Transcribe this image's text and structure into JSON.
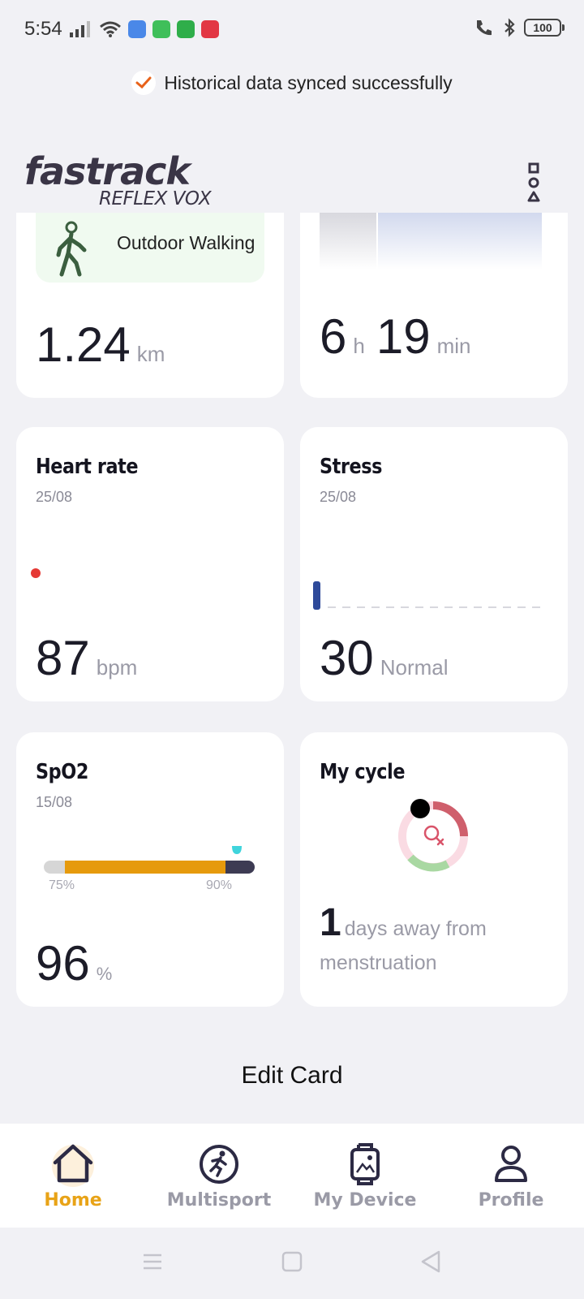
{
  "status_bar": {
    "time": "5:54",
    "battery": "100",
    "app_badges": [
      {
        "icon": "calendar-app-icon",
        "color": "#4a88e8"
      },
      {
        "icon": "chat-app-icon",
        "color": "#3fbf5a"
      },
      {
        "icon": "store-app-icon",
        "color": "#2fae4a"
      },
      {
        "icon": "zomato-app-icon",
        "color": "#e23744"
      }
    ]
  },
  "toast": {
    "text": "Historical data synced successfully"
  },
  "header": {
    "logo_main": "fastrack",
    "logo_sub": "REFLEX VOX"
  },
  "cards": {
    "activity": {
      "chip_label": "Outdoor Walking",
      "value": "1.24",
      "unit": "km"
    },
    "sleep": {
      "hours": "6",
      "hours_unit": "h",
      "minutes": "19",
      "minutes_unit": "min"
    },
    "heart_rate": {
      "title": "Heart rate",
      "date": "25/08",
      "value": "87",
      "unit": "bpm"
    },
    "stress": {
      "title": "Stress",
      "date": "25/08",
      "value": "30",
      "status": "Normal"
    },
    "spo2": {
      "title": "SpO2",
      "date": "15/08",
      "value": "96",
      "unit": "%",
      "label_low": "75%",
      "label_high": "90%",
      "marker_level": 0.96
    },
    "cycle": {
      "title": "My cycle",
      "days": "1",
      "text": "days away from menstruation"
    }
  },
  "edit_card": {
    "label": "Edit Card"
  },
  "nav": {
    "items": [
      {
        "label": "Home",
        "icon": "home-icon",
        "active": true
      },
      {
        "label": "Multisport",
        "icon": "multisport-icon",
        "active": false
      },
      {
        "label": "My Device",
        "icon": "watch-icon",
        "active": false
      },
      {
        "label": "Profile",
        "icon": "profile-icon",
        "active": false
      }
    ]
  },
  "colors": {
    "accent": "#e8a317",
    "heart": "#e53935",
    "stress": "#2e4a9a",
    "spo2_fill": "#e69a0c",
    "spo2_dark": "#3d3b53"
  }
}
